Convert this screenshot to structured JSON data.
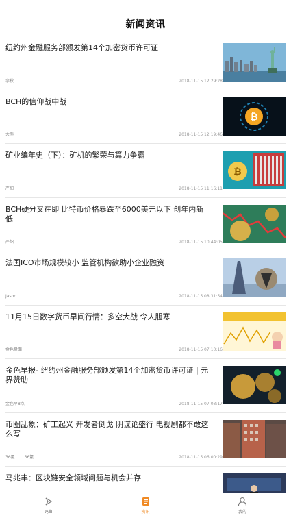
{
  "header": {
    "title": "新闻资讯"
  },
  "articles": [
    {
      "title": "纽约州金融服务部颁发第14个加密货币许可证",
      "source": "李秋",
      "time": "2018-11-15 12:29:28"
    },
    {
      "title": "BCH的信仰战中战",
      "source": "大熊",
      "time": "2018-11-15 12:19:46"
    },
    {
      "title": "矿业编年史（下）：矿机的繁荣与算力争霸",
      "source": "严韶",
      "time": "2018-11-15 11:16:11"
    },
    {
      "title": "BCH硬分叉在即 比特币价格暴跌至6000美元以下 创年内新低",
      "source": "严韶",
      "time": "2018-11-15 10:44:05"
    },
    {
      "title": "法国ICO市场规模较小 监管机构欲助小企业融资",
      "source": "Jason.",
      "time": "2018-11-15 08:31:54"
    },
    {
      "title": "11月15日数字货币早间行情：多空大战 令人胆寒",
      "source": "金色盘面",
      "time": "2018-11-15 07:10:16"
    },
    {
      "title": "金色早报- 纽约州金融服务部颁发第14个加密货币许可证 | 元界赞助",
      "source": "金色早8点",
      "time": "2018-11-15 07:03:17"
    },
    {
      "title": "币圈乱象：矿工起义 开发者倒戈 阴谋论盛行 电视剧都不敢这么写",
      "source": "36氪",
      "source_extra": "36氪",
      "time": "2018-11-15 06:00:29"
    },
    {
      "title": "马兆丰：区块链安全领域问题与机会并存",
      "source": "",
      "time": ""
    }
  ],
  "tabbar": {
    "items": [
      {
        "label": "鸣鱼",
        "icon": "kite-logo-icon",
        "active": false
      },
      {
        "label": "资讯",
        "icon": "news-document-icon",
        "active": true
      },
      {
        "label": "我的",
        "icon": "person-icon",
        "active": false
      }
    ],
    "active_color": "#f08a24",
    "inactive_color": "#777777"
  }
}
